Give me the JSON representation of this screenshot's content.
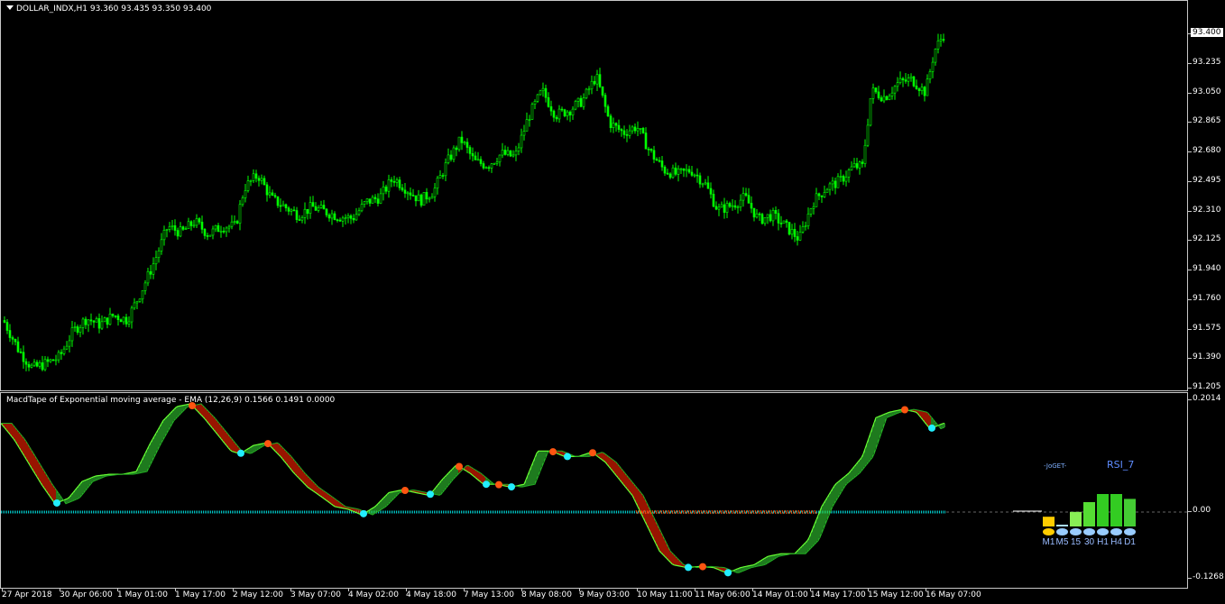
{
  "main_chart": {
    "title": "DOLLAR_INDX,H1  93.360 93.435 93.350 93.400",
    "price_labels": [
      "93.400",
      "93.235",
      "93.050",
      "92.865",
      "92.680",
      "92.495",
      "92.310",
      "92.125",
      "91.940",
      "91.760",
      "91.575",
      "91.390",
      "91.205"
    ],
    "current_price": "93.400",
    "candle_color": "#00ff00"
  },
  "macd": {
    "title": "MacdTape of Exponential moving average - EMA (12,26,9) 0.1566 0.1491 0.0000",
    "axis_labels": [
      "0.2014",
      "0.00",
      "-0.1268"
    ],
    "widget": {
      "brand": "-JoGET-",
      "indicator": "RSI_7",
      "timeframes": [
        "M1",
        "M5",
        "15",
        "30",
        "H1",
        "H4",
        "D1"
      ],
      "bar_levels": [
        0.3,
        0.05,
        0.45,
        0.75,
        1.0,
        1.0,
        0.85
      ]
    },
    "colors": {
      "up": "#33cc33",
      "down": "#ff2200",
      "dot_down": "#ff5511",
      "dot_up": "#22eeff",
      "zero": "#00cccc"
    }
  },
  "time_labels": [
    "27 Apr 2018",
    "30 Apr 06:00",
    "1 May 01:00",
    "1 May 17:00",
    "2 May 12:00",
    "3 May 07:00",
    "4 May 02:00",
    "4 May 18:00",
    "7 May 13:00",
    "8 May 08:00",
    "9 May 03:00",
    "10 May 11:00",
    "11 May 06:00",
    "14 May 01:00",
    "14 May 17:00",
    "15 May 12:00",
    "16 May 07:00"
  ],
  "chart_data": {
    "type": "candlestick",
    "symbol": "DOLLAR_INDX",
    "timeframe": "H1",
    "ylim": [
      91.205,
      93.435
    ],
    "close_path": [
      [
        0,
        91.66
      ],
      [
        20,
        91.44
      ],
      [
        35,
        91.33
      ],
      [
        50,
        91.36
      ],
      [
        65,
        91.4
      ],
      [
        80,
        91.56
      ],
      [
        95,
        91.64
      ],
      [
        110,
        91.6
      ],
      [
        125,
        91.66
      ],
      [
        140,
        91.63
      ],
      [
        155,
        91.8
      ],
      [
        170,
        91.99
      ],
      [
        185,
        92.21
      ],
      [
        200,
        92.17
      ],
      [
        215,
        92.24
      ],
      [
        230,
        92.16
      ],
      [
        245,
        92.21
      ],
      [
        260,
        92.21
      ],
      [
        270,
        92.45
      ],
      [
        285,
        92.53
      ],
      [
        300,
        92.38
      ],
      [
        315,
        92.33
      ],
      [
        330,
        92.28
      ],
      [
        345,
        92.33
      ],
      [
        360,
        92.3
      ],
      [
        375,
        92.27
      ],
      [
        390,
        92.26
      ],
      [
        405,
        92.36
      ],
      [
        420,
        92.39
      ],
      [
        435,
        92.51
      ],
      [
        450,
        92.44
      ],
      [
        465,
        92.37
      ],
      [
        480,
        92.43
      ],
      [
        495,
        92.61
      ],
      [
        510,
        92.75
      ],
      [
        525,
        92.61
      ],
      [
        540,
        92.59
      ],
      [
        555,
        92.66
      ],
      [
        570,
        92.64
      ],
      [
        585,
        92.89
      ],
      [
        600,
        93.05
      ],
      [
        615,
        92.9
      ],
      [
        630,
        92.93
      ],
      [
        645,
        92.99
      ],
      [
        660,
        93.14
      ],
      [
        675,
        92.85
      ],
      [
        690,
        92.79
      ],
      [
        705,
        92.83
      ],
      [
        720,
        92.67
      ],
      [
        735,
        92.56
      ],
      [
        750,
        92.53
      ],
      [
        765,
        92.56
      ],
      [
        780,
        92.48
      ],
      [
        795,
        92.31
      ],
      [
        810,
        92.34
      ],
      [
        825,
        92.39
      ],
      [
        840,
        92.25
      ],
      [
        855,
        92.28
      ],
      [
        870,
        92.21
      ],
      [
        885,
        92.13
      ],
      [
        900,
        92.36
      ],
      [
        915,
        92.45
      ],
      [
        930,
        92.49
      ],
      [
        945,
        92.58
      ],
      [
        955,
        92.58
      ],
      [
        965,
        93.05
      ],
      [
        980,
        93.01
      ],
      [
        995,
        93.1
      ],
      [
        1010,
        93.12
      ],
      [
        1025,
        93.04
      ],
      [
        1035,
        93.3
      ],
      [
        1045,
        93.4
      ]
    ],
    "macd_path": [
      [
        0,
        0.16
      ],
      [
        15,
        0.13
      ],
      [
        30,
        0.09
      ],
      [
        45,
        0.05
      ],
      [
        60,
        0.015
      ],
      [
        75,
        0.025
      ],
      [
        90,
        0.055
      ],
      [
        105,
        0.065
      ],
      [
        120,
        0.068
      ],
      [
        135,
        0.068
      ],
      [
        150,
        0.073
      ],
      [
        165,
        0.122
      ],
      [
        180,
        0.165
      ],
      [
        195,
        0.19
      ],
      [
        210,
        0.195
      ],
      [
        225,
        0.17
      ],
      [
        240,
        0.14
      ],
      [
        255,
        0.11
      ],
      [
        265,
        0.105
      ],
      [
        280,
        0.12
      ],
      [
        295,
        0.125
      ],
      [
        310,
        0.1
      ],
      [
        325,
        0.07
      ],
      [
        340,
        0.045
      ],
      [
        355,
        0.028
      ],
      [
        370,
        0.01
      ],
      [
        385,
        0.005
      ],
      [
        400,
        -0.005
      ],
      [
        415,
        0.01
      ],
      [
        430,
        0.035
      ],
      [
        445,
        0.04
      ],
      [
        460,
        0.035
      ],
      [
        475,
        0.03
      ],
      [
        490,
        0.06
      ],
      [
        505,
        0.085
      ],
      [
        520,
        0.07
      ],
      [
        535,
        0.05
      ],
      [
        550,
        0.05
      ],
      [
        565,
        0.045
      ],
      [
        580,
        0.05
      ],
      [
        595,
        0.11
      ],
      [
        610,
        0.11
      ],
      [
        625,
        0.1
      ],
      [
        640,
        0.1
      ],
      [
        655,
        0.108
      ],
      [
        670,
        0.09
      ],
      [
        685,
        0.06
      ],
      [
        700,
        0.03
      ],
      [
        715,
        -0.02
      ],
      [
        730,
        -0.07
      ],
      [
        745,
        -0.095
      ],
      [
        760,
        -0.1
      ],
      [
        775,
        -0.098
      ],
      [
        790,
        -0.1
      ],
      [
        805,
        -0.11
      ],
      [
        820,
        -0.1
      ],
      [
        835,
        -0.095
      ],
      [
        850,
        -0.08
      ],
      [
        865,
        -0.075
      ],
      [
        880,
        -0.075
      ],
      [
        895,
        -0.05
      ],
      [
        910,
        0.01
      ],
      [
        925,
        0.05
      ],
      [
        940,
        0.07
      ],
      [
        955,
        0.1
      ],
      [
        970,
        0.17
      ],
      [
        985,
        0.18
      ],
      [
        1000,
        0.185
      ],
      [
        1015,
        0.18
      ],
      [
        1030,
        0.15
      ],
      [
        1045,
        0.16
      ]
    ]
  }
}
